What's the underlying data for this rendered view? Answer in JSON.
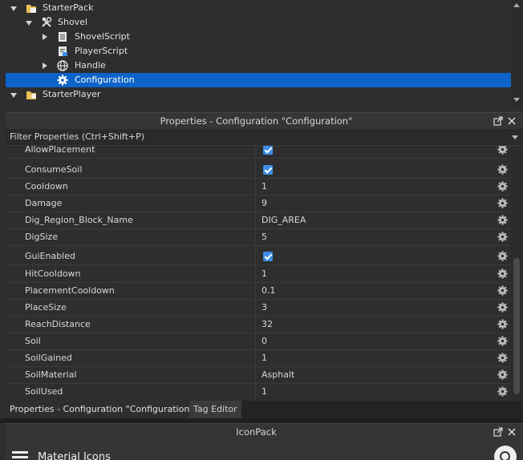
{
  "explorer": {
    "items": [
      {
        "label": "StarterPack",
        "icon": "starterpack-folder-icon",
        "expanded": true
      },
      {
        "label": "Shovel",
        "icon": "tool-icon",
        "expanded": true
      },
      {
        "label": "ShovelScript",
        "icon": "script-icon",
        "expanded": false
      },
      {
        "label": "PlayerScript",
        "icon": "local-script-icon"
      },
      {
        "label": "Handle",
        "icon": "part-globe-icon",
        "expanded": false
      },
      {
        "label": "Configuration",
        "icon": "gear-icon",
        "selected": true
      },
      {
        "label": "StarterPlayer",
        "icon": "starterplayer-folder-icon",
        "expanded": true
      }
    ]
  },
  "properties": {
    "title": "Properties - Configuration \"Configuration\"",
    "filter_placeholder": "Filter Properties (Ctrl+Shift+P)",
    "rows": [
      {
        "name": "AllowPlacement",
        "value": "",
        "checked": true
      },
      {
        "name": "ConsumeSoil",
        "value": "",
        "checked": true
      },
      {
        "name": "Cooldown",
        "value": "1"
      },
      {
        "name": "Damage",
        "value": "9"
      },
      {
        "name": "Dig_Region_Block_Name",
        "value": "DIG_AREA"
      },
      {
        "name": "DigSize",
        "value": "5"
      },
      {
        "name": "GuiEnabled",
        "value": "",
        "checked": true
      },
      {
        "name": "HitCooldown",
        "value": "1"
      },
      {
        "name": "PlacementCooldown",
        "value": "0.1"
      },
      {
        "name": "PlaceSize",
        "value": "3"
      },
      {
        "name": "ReachDistance",
        "value": "32"
      },
      {
        "name": "Soil",
        "value": "0"
      },
      {
        "name": "SoilGained",
        "value": "1"
      },
      {
        "name": "SoilMaterial",
        "value": "Asphalt"
      },
      {
        "name": "SoilUsed",
        "value": "1"
      }
    ]
  },
  "tabs": [
    {
      "label": "Properties - Configuration \"Configuration\"",
      "active": true
    },
    {
      "label": "Tag Editor",
      "active": false
    }
  ],
  "iconpack": {
    "title": "IconPack",
    "menu_label": "Material Icons"
  },
  "colors": {
    "selection": "#0d63c8",
    "checkbox": "#3d8ee8"
  }
}
